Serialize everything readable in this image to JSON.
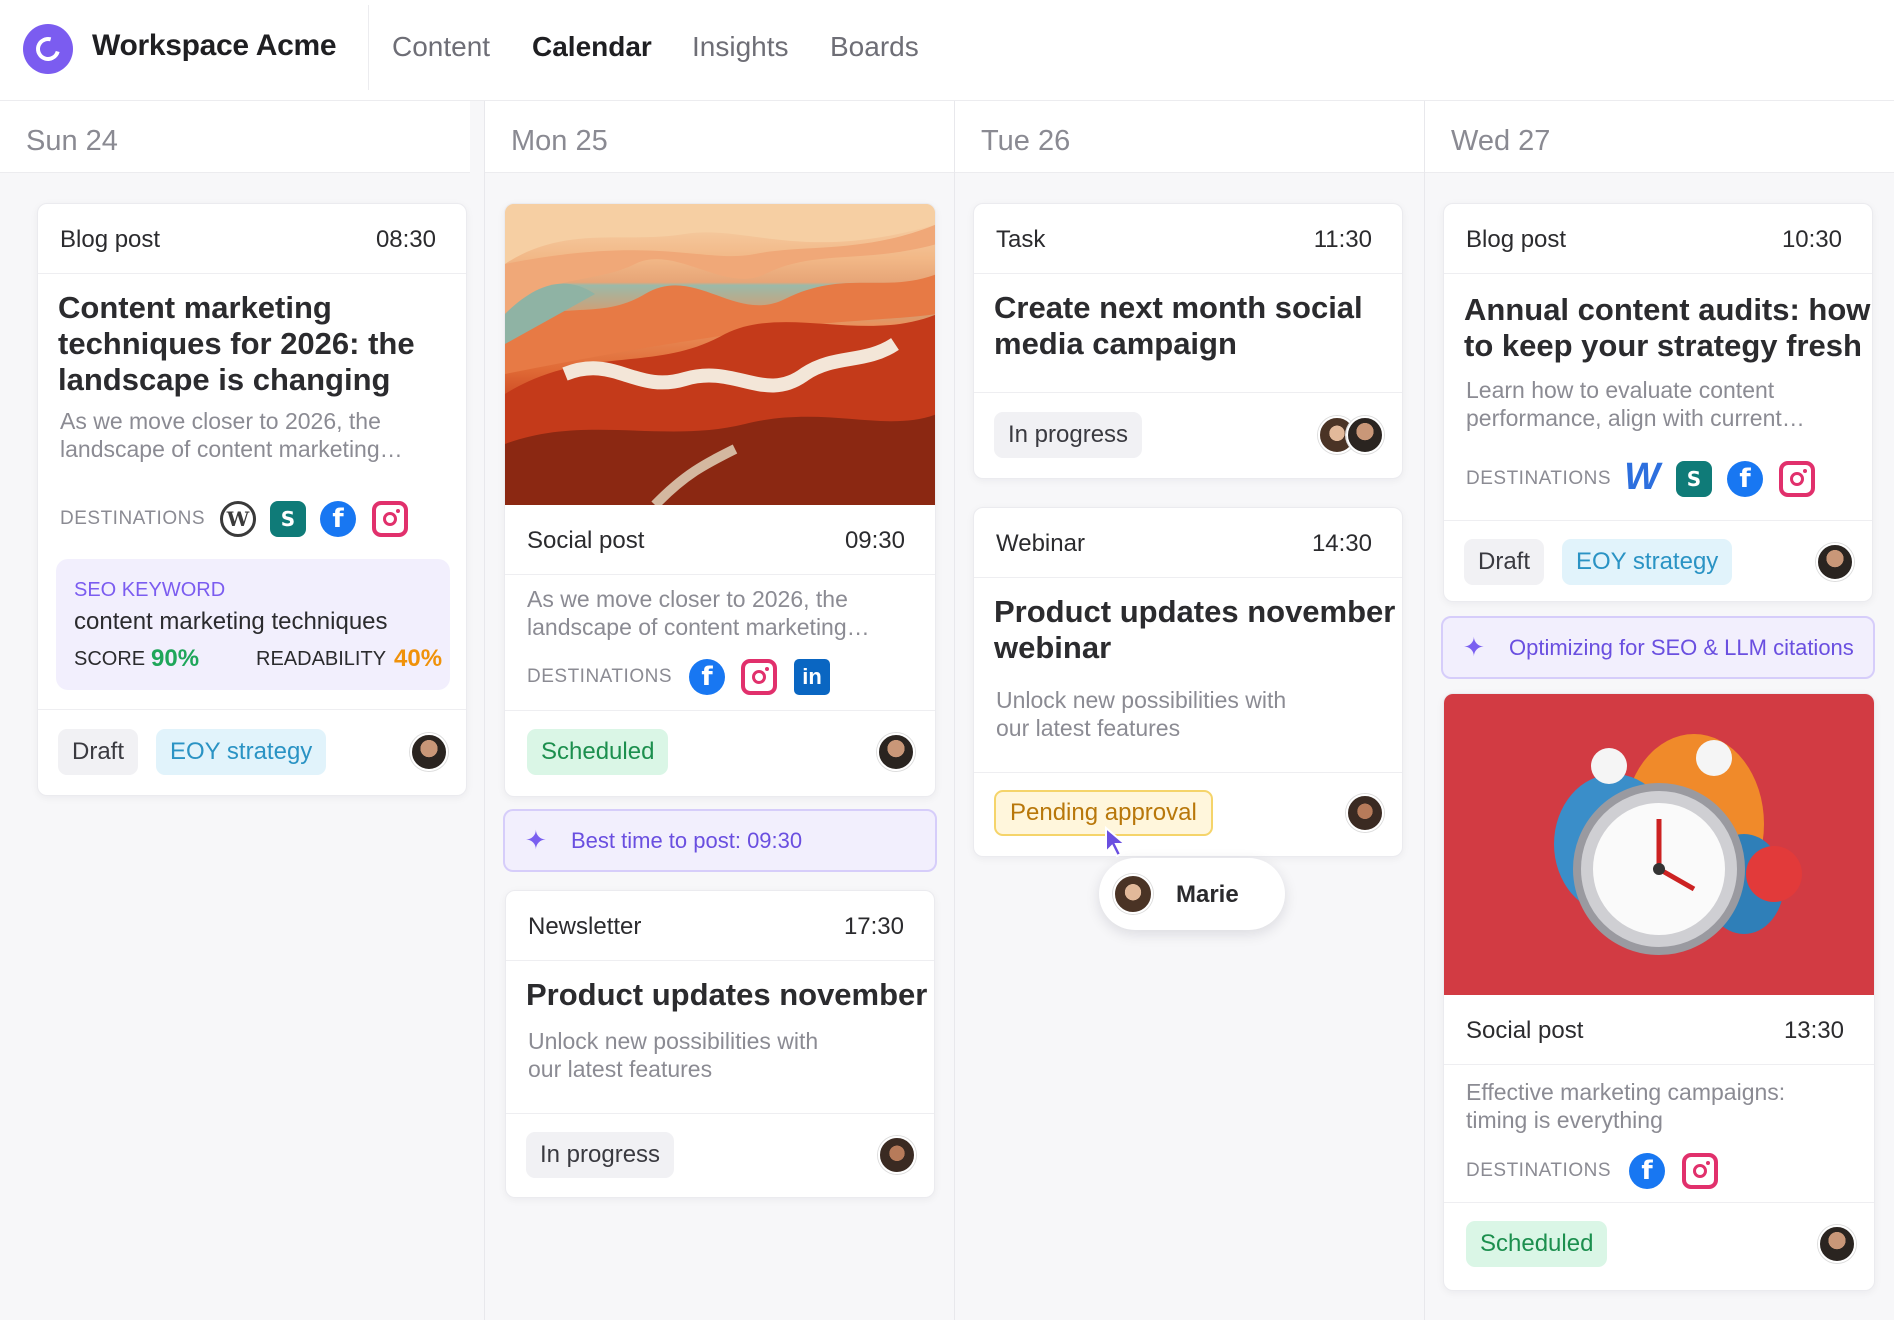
{
  "app": {
    "workspace": "Workspace Acme"
  },
  "nav": [
    {
      "label": "Content"
    },
    {
      "label": "Calendar"
    },
    {
      "label": "Insights"
    },
    {
      "label": "Boards"
    }
  ],
  "days": [
    {
      "label": "Sun 24"
    },
    {
      "label": "Mon 25"
    },
    {
      "label": "Tue 26"
    },
    {
      "label": "Wed 27"
    }
  ],
  "labels": {
    "destinations": "DESTINATIONS",
    "seo_keyword": "SEO KEYWORD",
    "score": "SCORE",
    "readability": "READABILITY"
  },
  "sun": {
    "card1": {
      "type": "Blog post",
      "time": "08:30",
      "title_l1": "Content marketing",
      "title_l2": "techniques for 2026: the",
      "title_l3": "landscape is changing",
      "desc_l1": "As we move closer to 2026, the",
      "desc_l2": "landscape of content marketing…",
      "seo_keyword": "content marketing techniques",
      "score": "90%",
      "readability": "40%",
      "status": "Draft",
      "tag": "EOY strategy",
      "destinations": [
        "wordpress-icon",
        "sharepoint-icon",
        "facebook-icon",
        "instagram-icon"
      ]
    }
  },
  "mon": {
    "card1": {
      "type": "Social post",
      "time": "09:30",
      "desc_l1": "As we move closer to 2026, the",
      "desc_l2": "landscape of content marketing…",
      "status": "Scheduled",
      "destinations": [
        "facebook-icon",
        "instagram-icon",
        "linkedin-icon"
      ]
    },
    "ai_tip": "Best time to post: 09:30",
    "card2": {
      "type": "Newsletter",
      "time": "17:30",
      "title": "Product updates november",
      "desc_l1": "Unlock new possibilities with",
      "desc_l2": "our latest features",
      "status": "In progress"
    }
  },
  "tue": {
    "card1": {
      "type": "Task",
      "time": "11:30",
      "title_l1": "Create next month social",
      "title_l2": "media campaign",
      "status": "In progress"
    },
    "card2": {
      "type": "Webinar",
      "time": "14:30",
      "title_l1": "Product updates november",
      "title_l2": "webinar",
      "desc_l1": "Unlock new possibilities with",
      "desc_l2": "our latest features",
      "status": "Pending approval"
    },
    "cursor_user": "Marie"
  },
  "wed": {
    "card1": {
      "type": "Blog post",
      "time": "10:30",
      "title_l1": "Annual content audits: how",
      "title_l2": "to keep your strategy fresh",
      "desc_l1": "Learn how to evaluate content",
      "desc_l2": "performance, align with current…",
      "status": "Draft",
      "tag": "EOY strategy",
      "destinations": [
        "webflow-icon",
        "sharepoint-icon",
        "facebook-icon",
        "instagram-icon"
      ]
    },
    "ai_tip": "Optimizing for SEO & LLM citations",
    "card2": {
      "type": "Social post",
      "time": "13:30",
      "desc_l1": "Effective marketing campaigns:",
      "desc_l2": "timing is everything",
      "status": "Scheduled",
      "destinations": [
        "facebook-icon",
        "instagram-icon"
      ]
    }
  },
  "colors": {
    "accent": "#7b5cf0",
    "score_green": "#1fa65a",
    "readability_orange": "#f0920a"
  }
}
